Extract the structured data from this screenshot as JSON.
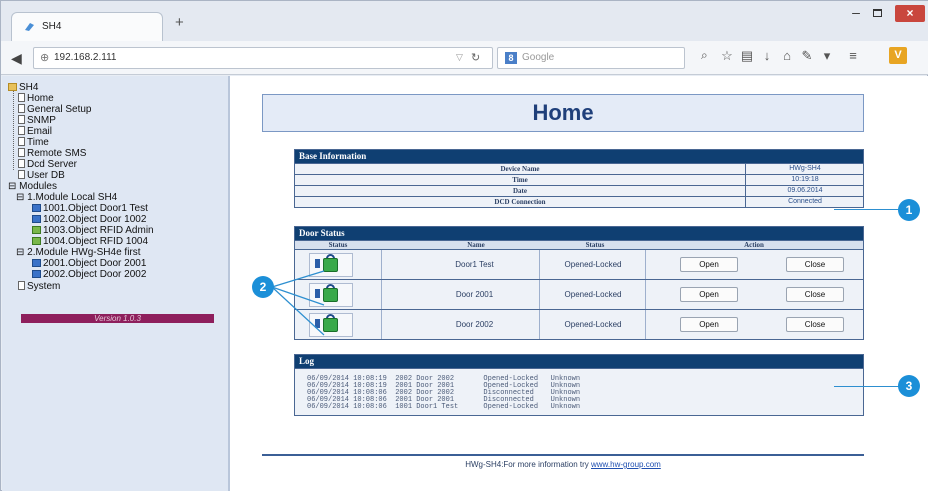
{
  "browser": {
    "tab_title": "SH4",
    "new_tab": "+",
    "url": "192.168.2.111",
    "search_placeholder": "Google",
    "search_engine_badge": "8"
  },
  "sidebar": {
    "root": "SH4",
    "items": [
      "Home",
      "General Setup",
      "SNMP",
      "Email",
      "Time",
      "Remote SMS",
      "Dcd Server",
      "User DB"
    ],
    "modules_label": "Modules",
    "module1": "1.Module Local SH4",
    "module1_items": [
      "1001.Object Door1 Test",
      "1002.Object Door 1002",
      "1003.Object RFID Admin",
      "1004.Object RFID 1004"
    ],
    "module2": "2.Module HWg-SH4e first",
    "module2_items": [
      "2001.Object Door 2001",
      "2002.Object Door 2002"
    ],
    "system": "System",
    "version": "Version 1.0.3"
  },
  "main": {
    "title": "Home",
    "base_info": {
      "heading": "Base Information",
      "rows": [
        {
          "label": "Device Name",
          "value": "HWg-SH4"
        },
        {
          "label": "Time",
          "value": "10:19:18"
        },
        {
          "label": "Date",
          "value": "09.06.2014"
        },
        {
          "label": "DCD Connection",
          "value": "Connected"
        }
      ]
    },
    "door_status": {
      "heading": "Door Status",
      "columns": {
        "status": "Status",
        "name": "Name",
        "state": "Status",
        "action": "Action"
      },
      "rows": [
        {
          "name": "Door1 Test",
          "status": "Opened-Locked",
          "open": "Open",
          "close": "Close"
        },
        {
          "name": "Door 2001",
          "status": "Opened-Locked",
          "open": "Open",
          "close": "Close"
        },
        {
          "name": "Door 2002",
          "status": "Opened-Locked",
          "open": "Open",
          "close": "Close"
        }
      ]
    },
    "log": {
      "heading": "Log",
      "lines": [
        "06/09/2014 10:08:19  2002 Door 2002       Opened-Locked   Unknown",
        "06/09/2014 10:08:19  2001 Door 2001       Opened-Locked   Unknown",
        "06/09/2014 10:08:06  2002 Door 2002       Disconnected    Unknown",
        "06/09/2014 10:08:06  2001 Door 2001       Disconnected    Unknown",
        "06/09/2014 10:08:06  1001 Door1 Test      Opened-Locked   Unknown"
      ]
    },
    "footer_text": "HWg-SH4:For more information try ",
    "footer_link": "www.hw-group.com"
  },
  "callouts": [
    "1",
    "2",
    "3"
  ],
  "colors": {
    "header_bg": "#0f3f72",
    "accent": "#1b8fd8",
    "version_bar": "#8e1f5c"
  }
}
